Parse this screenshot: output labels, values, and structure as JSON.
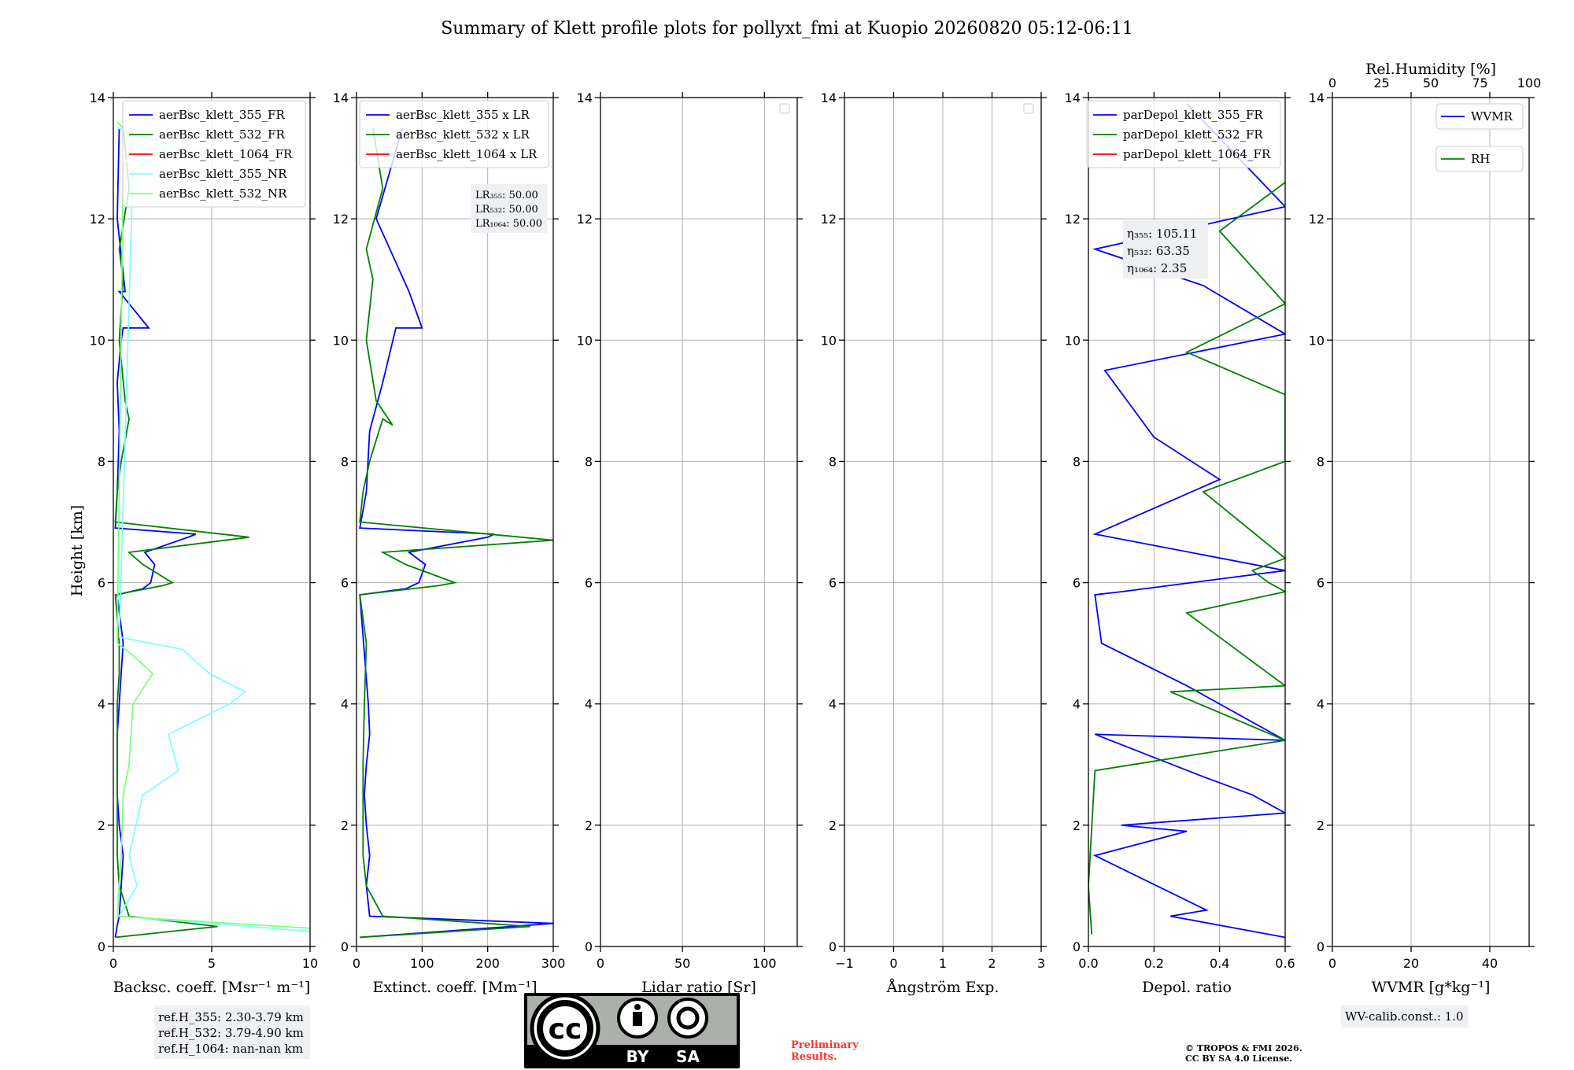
{
  "title": "Summary of Klett profile plots for pollyxt_fmi at Kuopio 20260820 05:12-06:11",
  "y_label": "Height [km]",
  "y_ticks": [
    "0",
    "2",
    "4",
    "6",
    "8",
    "10",
    "12",
    "14"
  ],
  "ylim": [
    0,
    14
  ],
  "colors": {
    "ch355_FR": "#0000ff",
    "ch532_FR": "#008000",
    "ch1064_FR": "#ff0000",
    "ch355_NR": "#80ffff",
    "ch532_NR": "#80ff80",
    "grid": "#b0b0b0",
    "preliminary": "#ff3333"
  },
  "chart_data": [
    {
      "type": "line",
      "xlabel": "Backsc. coeff. [Msr⁻¹ m⁻¹]",
      "xlim": [
        0,
        10
      ],
      "x_ticks": [
        "0",
        "5",
        "10"
      ],
      "x_tick_values": [
        0,
        5,
        10
      ],
      "legend": [
        "aerBsc_klett_355_FR",
        "aerBsc_klett_532_FR",
        "aerBsc_klett_1064_FR",
        "aerBsc_klett_355_NR",
        "aerBsc_klett_532_NR"
      ],
      "legend_placement": "top-right",
      "series": [
        {
          "name": "aerBsc_klett_355_FR",
          "color_key": "ch355_FR",
          "x": [
            0.1,
            0.2,
            0.3,
            0.4,
            0.5,
            0.3,
            0.2,
            0.2,
            0.2,
            0.3,
            0.5,
            0.2,
            1.5,
            1.9,
            2.1,
            1.6,
            3.8,
            4.2,
            0.1,
            0.2,
            0.3,
            0.2,
            0.4,
            0.5,
            1.8,
            0.3,
            0.6,
            0.2,
            0.3
          ],
          "y": [
            0.15,
            0.35,
            0.5,
            1.0,
            1.5,
            2.0,
            2.5,
            3.0,
            3.5,
            4.0,
            5.0,
            5.8,
            5.9,
            6.0,
            6.3,
            6.5,
            6.75,
            6.8,
            6.9,
            7.5,
            8.5,
            9.3,
            10.0,
            10.2,
            10.2,
            10.8,
            10.8,
            12.0,
            13.5
          ]
        },
        {
          "name": "aerBsc_klett_532_FR",
          "color_key": "ch532_FR",
          "x": [
            0.1,
            5.3,
            0.8,
            0.3,
            0.2,
            0.2,
            0.2,
            0.2,
            0.2,
            0.3,
            0.3,
            0.1,
            2.5,
            3.0,
            1.5,
            0.8,
            6.9,
            0.1,
            0.2,
            0.4,
            0.8,
            0.6,
            0.3,
            0.5,
            0.3,
            0.8,
            0.5
          ],
          "y": [
            0.15,
            0.33,
            0.5,
            1.0,
            1.5,
            2.0,
            2.5,
            3.0,
            4.0,
            4.5,
            5.0,
            5.8,
            5.95,
            6.0,
            6.3,
            6.5,
            6.75,
            7.0,
            7.5,
            8.0,
            8.7,
            9.0,
            10.0,
            11.0,
            11.5,
            12.5,
            13.5
          ]
        },
        {
          "name": "aerBsc_klett_355_NR",
          "color_key": "ch355_NR",
          "x": [
            10,
            0.3,
            1.2,
            0.8,
            1.5,
            3.3,
            2.8,
            5.9,
            6.7,
            4.9,
            3.5,
            0.3,
            1.0,
            3.0,
            0.2
          ],
          "y": [
            0.25,
            0.5,
            1.0,
            1.5,
            2.5,
            2.9,
            3.5,
            4.0,
            4.2,
            4.5,
            4.9,
            5.1,
            12.8,
            13.2,
            13.5
          ]
        },
        {
          "name": "aerBsc_klett_532_NR",
          "color_key": "ch532_NR",
          "x": [
            10,
            0.2,
            0.4,
            0.5,
            0.8,
            1.0,
            2.0,
            1.0,
            0.2,
            0.5,
            1.0,
            0.2
          ],
          "y": [
            0.3,
            0.5,
            1.5,
            2.5,
            3.0,
            4.0,
            4.5,
            4.8,
            5.0,
            12.8,
            13.3,
            13.6
          ]
        }
      ]
    },
    {
      "type": "line",
      "xlabel": "Extinct. coeff. [Mm⁻¹]",
      "xlim": [
        0,
        300
      ],
      "x_ticks": [
        "0",
        "100",
        "200",
        "300"
      ],
      "x_tick_values": [
        0,
        100,
        200,
        300
      ],
      "legend": [
        "aerBsc_klett_355 x LR",
        "aerBsc_klett_532 x LR",
        "aerBsc_klett_1064 x LR"
      ],
      "legend_placement": "top-right",
      "annotation": [
        "LR₃₅₅: 50.00",
        "LR₅₃₂: 50.00",
        "LR₁₀₆₄: 50.00"
      ],
      "series": [
        {
          "name": "aerBsc_klett_355 x LR",
          "color_key": "ch355_FR",
          "x": [
            5,
            300,
            20,
            15,
            20,
            15,
            12,
            15,
            20,
            18,
            5,
            75,
            95,
            105,
            80,
            200,
            210,
            5,
            15,
            20,
            40,
            60,
            100,
            80,
            30,
            70
          ],
          "y": [
            0.15,
            0.38,
            0.5,
            1.0,
            1.5,
            2.0,
            2.5,
            3.0,
            3.5,
            4.0,
            5.8,
            5.9,
            6.0,
            6.3,
            6.5,
            6.75,
            6.8,
            6.9,
            7.5,
            8.5,
            9.3,
            10.2,
            10.2,
            10.8,
            12.0,
            13.5
          ]
        },
        {
          "name": "aerBsc_klett_532 x LR",
          "color_key": "ch532_FR",
          "x": [
            5,
            265,
            40,
            15,
            10,
            10,
            10,
            10,
            12,
            15,
            5,
            125,
            150,
            75,
            40,
            300,
            5,
            10,
            20,
            40,
            55,
            30,
            15,
            25,
            15,
            40,
            25
          ],
          "y": [
            0.15,
            0.33,
            0.5,
            1.0,
            1.5,
            2.0,
            2.5,
            3.0,
            4.0,
            5.0,
            5.8,
            5.95,
            6.0,
            6.3,
            6.5,
            6.7,
            7.0,
            7.5,
            8.0,
            8.7,
            8.6,
            9.0,
            10.0,
            11.0,
            11.5,
            12.5,
            13.5
          ]
        }
      ]
    },
    {
      "type": "line",
      "xlabel": "Lidar ratio [Sr]",
      "xlim": [
        0,
        120
      ],
      "x_ticks": [
        "0",
        "50",
        "100"
      ],
      "x_tick_values": [
        0,
        50,
        100
      ],
      "series": []
    },
    {
      "type": "line",
      "xlabel": "Ångström Exp.",
      "xlim": [
        -1,
        3
      ],
      "x_ticks": [
        "−1",
        "0",
        "1",
        "2",
        "3"
      ],
      "x_tick_values": [
        -1,
        0,
        1,
        2,
        3
      ],
      "series": []
    },
    {
      "type": "line",
      "xlabel": "Depol. ratio",
      "xlim": [
        0,
        0.6
      ],
      "x_ticks": [
        "0.0",
        "0.2",
        "0.4",
        "0.6"
      ],
      "x_tick_values": [
        0,
        0.2,
        0.4,
        0.6
      ],
      "legend": [
        "parDepol_klett_355_FR",
        "parDepol_klett_532_FR",
        "parDepol_klett_1064_FR"
      ],
      "legend_placement": "top-right",
      "annotation": [
        "η₃₅₅: 105.11",
        "η₅₃₂: 63.35",
        "η₁₀₆₄: 2.35"
      ],
      "series": [
        {
          "name": "parDepol_klett_355_FR",
          "color_key": "ch355_FR",
          "x": [
            0.6,
            0.25,
            0.36,
            0.02,
            0.3,
            0.1,
            0.6,
            0.5,
            0.35,
            0.02,
            0.6,
            0.3,
            0.04,
            0.02,
            0.1,
            0.6,
            0.02,
            0.4,
            0.2,
            0.05,
            0.6,
            0.35,
            0.02,
            0.6,
            0.3
          ],
          "y": [
            0.15,
            0.5,
            0.6,
            1.5,
            1.9,
            2.0,
            2.2,
            2.5,
            2.8,
            3.5,
            3.4,
            4.3,
            5.0,
            5.8,
            5.85,
            6.2,
            6.8,
            7.7,
            8.4,
            9.5,
            10.1,
            10.9,
            11.5,
            12.2,
            13.9
          ]
        },
        {
          "name": "parDepol_klett_532_FR",
          "color_key": "ch532_FR",
          "x": [
            0.01,
            0.0,
            0.02,
            0.6,
            0.25,
            0.6,
            0.3,
            0.6,
            0.55,
            0.5,
            0.6,
            0.35,
            0.6,
            0.6,
            0.3,
            0.6,
            0.4,
            0.6
          ],
          "y": [
            0.2,
            1.0,
            2.9,
            3.4,
            4.2,
            4.3,
            5.5,
            5.85,
            6.0,
            6.2,
            6.4,
            7.5,
            8.0,
            9.1,
            9.8,
            10.6,
            11.8,
            12.6
          ]
        }
      ]
    },
    {
      "type": "line",
      "xlabel": "WVMR [g*kg⁻¹]",
      "xlim": [
        0,
        50
      ],
      "x_ticks": [
        "0",
        "20",
        "40"
      ],
      "x_tick_values": [
        0,
        20,
        40
      ],
      "top_xlabel": "Rel.Humidity [%]",
      "top_xlim": [
        0,
        100
      ],
      "top_x_ticks": [
        "0",
        "25",
        "50",
        "75",
        "100"
      ],
      "top_x_tick_values": [
        0,
        25,
        50,
        75,
        100
      ],
      "legend": [
        "WVMR",
        "RH"
      ],
      "legend_placement": "top-right",
      "series": []
    }
  ],
  "notes": {
    "ref_heights": [
      "ref.H_355: 2.30-3.79 km",
      "ref.H_532: 3.79-4.90 km",
      "ref.H_1064: nan-nan km"
    ],
    "wv_calib": "WV-calib.const.: 1.0",
    "preliminary": [
      "Preliminary",
      "Results."
    ],
    "copyright": [
      "© TROPOS & FMI 2026.",
      "CC BY SA 4.0 License."
    ]
  },
  "license_badge": {
    "icon": "cc-by-sa-icon",
    "cc_text": "cc",
    "by_text": "BY",
    "sa_text": "SA"
  }
}
